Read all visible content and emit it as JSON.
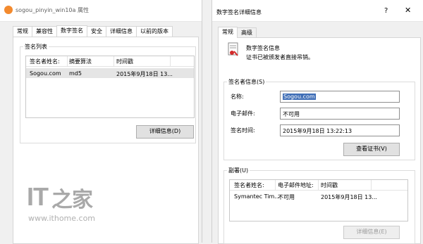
{
  "left_window": {
    "title": "sogou_pinyin_win10a 属性",
    "tabs": [
      "常规",
      "兼容性",
      "数字签名",
      "安全",
      "详细信息",
      "以前的版本"
    ],
    "active_tab": "数字签名",
    "signature_list": {
      "legend": "签名列表",
      "columns": [
        "签名者姓名:",
        "摘要算法",
        "时间戳"
      ],
      "rows": [
        {
          "name": "Sogou.com",
          "algorithm": "md5",
          "timestamp": "2015年9月18日 13..."
        }
      ]
    },
    "details_button": "详细信息(D)"
  },
  "right_window": {
    "title": "数字签名详细信息",
    "help_glyph": "?",
    "close_glyph": "✕",
    "tabs": [
      "常规",
      "高级"
    ],
    "active_tab": "常规",
    "sig_info_title": "数字签名信息",
    "sig_info_desc": "证书已被颁发者直接吊销。",
    "signer_group": {
      "legend": "签名者信息(S)",
      "name_label": "名称:",
      "name_value": "Sogou.com",
      "email_label": "电子邮件:",
      "email_value": "不可用",
      "time_label": "签名时间:",
      "time_value": "2015年9月18日 13:22:13",
      "view_cert_button": "查看证书(V)"
    },
    "countersign_group": {
      "legend": "副署(U)",
      "columns": [
        "签名者姓名:",
        "电子邮件地址:",
        "时间戳"
      ],
      "rows": [
        {
          "name": "Symantec Tim...",
          "email": "不可用",
          "timestamp": "2015年9月18日 13..."
        }
      ],
      "details_button": "详细信息(E)"
    }
  },
  "watermark": {
    "logo_text": "IT之家",
    "url": "www.ithome.com"
  }
}
